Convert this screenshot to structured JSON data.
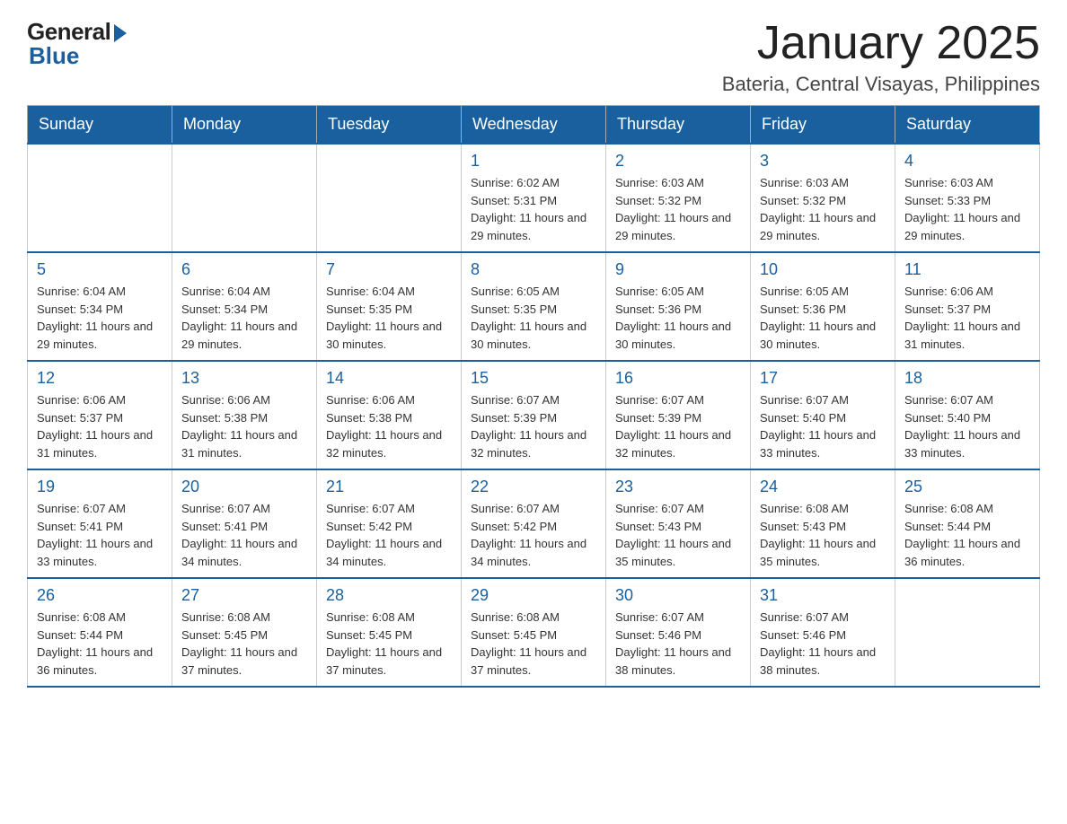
{
  "logo": {
    "general": "General",
    "blue": "Blue"
  },
  "header": {
    "month": "January 2025",
    "location": "Bateria, Central Visayas, Philippines"
  },
  "weekdays": [
    "Sunday",
    "Monday",
    "Tuesday",
    "Wednesday",
    "Thursday",
    "Friday",
    "Saturday"
  ],
  "weeks": [
    [
      {
        "day": "",
        "info": ""
      },
      {
        "day": "",
        "info": ""
      },
      {
        "day": "",
        "info": ""
      },
      {
        "day": "1",
        "info": "Sunrise: 6:02 AM\nSunset: 5:31 PM\nDaylight: 11 hours and 29 minutes."
      },
      {
        "day": "2",
        "info": "Sunrise: 6:03 AM\nSunset: 5:32 PM\nDaylight: 11 hours and 29 minutes."
      },
      {
        "day": "3",
        "info": "Sunrise: 6:03 AM\nSunset: 5:32 PM\nDaylight: 11 hours and 29 minutes."
      },
      {
        "day": "4",
        "info": "Sunrise: 6:03 AM\nSunset: 5:33 PM\nDaylight: 11 hours and 29 minutes."
      }
    ],
    [
      {
        "day": "5",
        "info": "Sunrise: 6:04 AM\nSunset: 5:34 PM\nDaylight: 11 hours and 29 minutes."
      },
      {
        "day": "6",
        "info": "Sunrise: 6:04 AM\nSunset: 5:34 PM\nDaylight: 11 hours and 29 minutes."
      },
      {
        "day": "7",
        "info": "Sunrise: 6:04 AM\nSunset: 5:35 PM\nDaylight: 11 hours and 30 minutes."
      },
      {
        "day": "8",
        "info": "Sunrise: 6:05 AM\nSunset: 5:35 PM\nDaylight: 11 hours and 30 minutes."
      },
      {
        "day": "9",
        "info": "Sunrise: 6:05 AM\nSunset: 5:36 PM\nDaylight: 11 hours and 30 minutes."
      },
      {
        "day": "10",
        "info": "Sunrise: 6:05 AM\nSunset: 5:36 PM\nDaylight: 11 hours and 30 minutes."
      },
      {
        "day": "11",
        "info": "Sunrise: 6:06 AM\nSunset: 5:37 PM\nDaylight: 11 hours and 31 minutes."
      }
    ],
    [
      {
        "day": "12",
        "info": "Sunrise: 6:06 AM\nSunset: 5:37 PM\nDaylight: 11 hours and 31 minutes."
      },
      {
        "day": "13",
        "info": "Sunrise: 6:06 AM\nSunset: 5:38 PM\nDaylight: 11 hours and 31 minutes."
      },
      {
        "day": "14",
        "info": "Sunrise: 6:06 AM\nSunset: 5:38 PM\nDaylight: 11 hours and 32 minutes."
      },
      {
        "day": "15",
        "info": "Sunrise: 6:07 AM\nSunset: 5:39 PM\nDaylight: 11 hours and 32 minutes."
      },
      {
        "day": "16",
        "info": "Sunrise: 6:07 AM\nSunset: 5:39 PM\nDaylight: 11 hours and 32 minutes."
      },
      {
        "day": "17",
        "info": "Sunrise: 6:07 AM\nSunset: 5:40 PM\nDaylight: 11 hours and 33 minutes."
      },
      {
        "day": "18",
        "info": "Sunrise: 6:07 AM\nSunset: 5:40 PM\nDaylight: 11 hours and 33 minutes."
      }
    ],
    [
      {
        "day": "19",
        "info": "Sunrise: 6:07 AM\nSunset: 5:41 PM\nDaylight: 11 hours and 33 minutes."
      },
      {
        "day": "20",
        "info": "Sunrise: 6:07 AM\nSunset: 5:41 PM\nDaylight: 11 hours and 34 minutes."
      },
      {
        "day": "21",
        "info": "Sunrise: 6:07 AM\nSunset: 5:42 PM\nDaylight: 11 hours and 34 minutes."
      },
      {
        "day": "22",
        "info": "Sunrise: 6:07 AM\nSunset: 5:42 PM\nDaylight: 11 hours and 34 minutes."
      },
      {
        "day": "23",
        "info": "Sunrise: 6:07 AM\nSunset: 5:43 PM\nDaylight: 11 hours and 35 minutes."
      },
      {
        "day": "24",
        "info": "Sunrise: 6:08 AM\nSunset: 5:43 PM\nDaylight: 11 hours and 35 minutes."
      },
      {
        "day": "25",
        "info": "Sunrise: 6:08 AM\nSunset: 5:44 PM\nDaylight: 11 hours and 36 minutes."
      }
    ],
    [
      {
        "day": "26",
        "info": "Sunrise: 6:08 AM\nSunset: 5:44 PM\nDaylight: 11 hours and 36 minutes."
      },
      {
        "day": "27",
        "info": "Sunrise: 6:08 AM\nSunset: 5:45 PM\nDaylight: 11 hours and 37 minutes."
      },
      {
        "day": "28",
        "info": "Sunrise: 6:08 AM\nSunset: 5:45 PM\nDaylight: 11 hours and 37 minutes."
      },
      {
        "day": "29",
        "info": "Sunrise: 6:08 AM\nSunset: 5:45 PM\nDaylight: 11 hours and 37 minutes."
      },
      {
        "day": "30",
        "info": "Sunrise: 6:07 AM\nSunset: 5:46 PM\nDaylight: 11 hours and 38 minutes."
      },
      {
        "day": "31",
        "info": "Sunrise: 6:07 AM\nSunset: 5:46 PM\nDaylight: 11 hours and 38 minutes."
      },
      {
        "day": "",
        "info": ""
      }
    ]
  ]
}
